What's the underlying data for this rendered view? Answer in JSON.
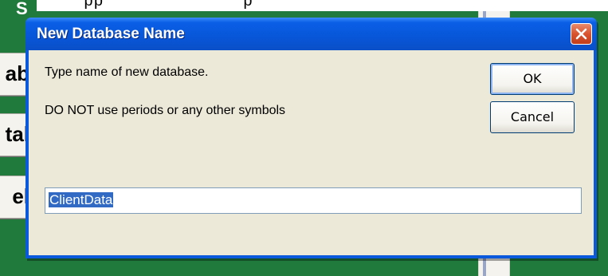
{
  "background": {
    "top_strip_text": "pp              p",
    "logo_fragment": "S",
    "button_fragments": [
      "ab",
      "tal",
      "el"
    ]
  },
  "dialog": {
    "title": "New Database Name",
    "message_line1": "Type name of new database.",
    "message_line2": "DO NOT use periods or any other symbols",
    "ok_label": "OK",
    "cancel_label": "Cancel",
    "input_value": "ClientData",
    "input_text_selected": true
  },
  "icons": {
    "close": "close-icon"
  },
  "colors": {
    "titlebar": "#0856d8",
    "close_button": "#d9542e",
    "dialog_face": "#ece9d8",
    "desktop": "#1f7a3c",
    "selection": "#316ac5"
  }
}
